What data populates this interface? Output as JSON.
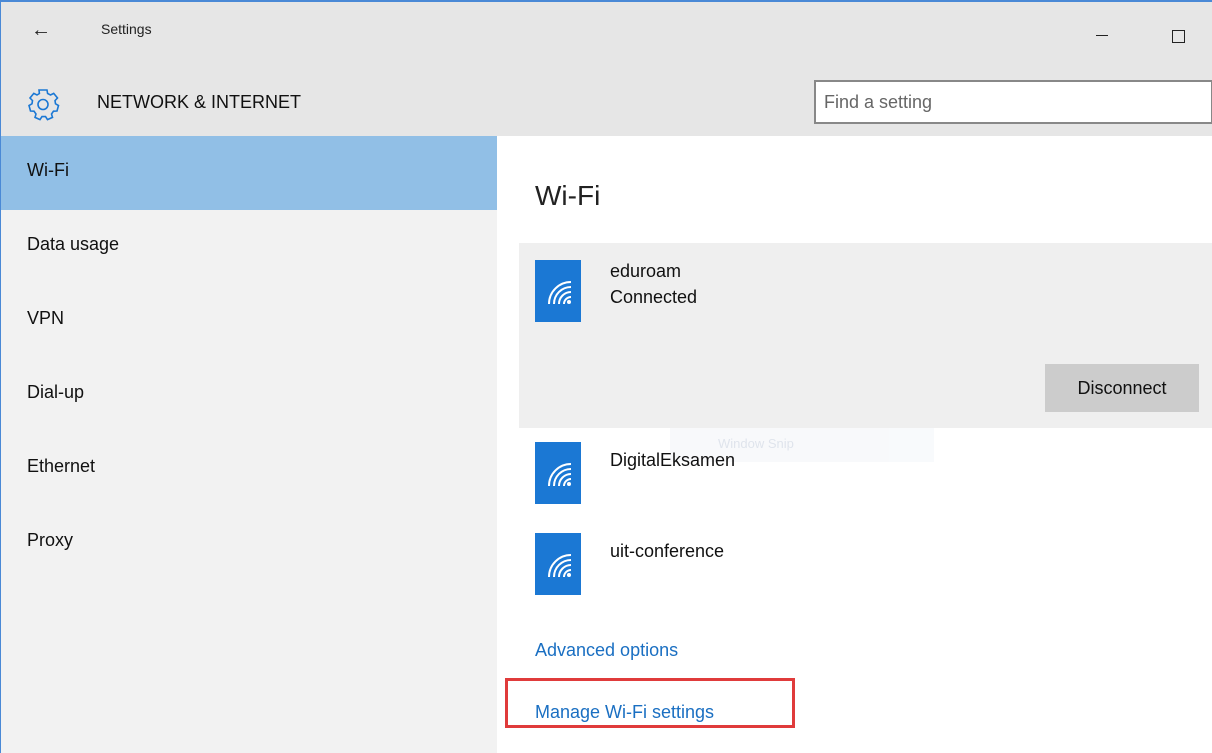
{
  "titlebar": {
    "back_icon": "back-arrow-icon",
    "title": "Settings",
    "minimize_icon": "minimize-icon",
    "maximize_icon": "maximize-icon"
  },
  "header": {
    "icon": "gear-icon",
    "section_title": "NETWORK & INTERNET",
    "search_placeholder": "Find a setting"
  },
  "sidebar": {
    "items": [
      {
        "label": "Wi-Fi",
        "active": true
      },
      {
        "label": "Data usage",
        "active": false
      },
      {
        "label": "VPN",
        "active": false
      },
      {
        "label": "Dial-up",
        "active": false
      },
      {
        "label": "Ethernet",
        "active": false
      },
      {
        "label": "Proxy",
        "active": false
      }
    ]
  },
  "main": {
    "title": "Wi-Fi",
    "networks": [
      {
        "name": "eduroam",
        "status": "Connected",
        "icon": "wifi-signal-icon"
      },
      {
        "name": "DigitalEksamen",
        "icon": "wifi-signal-icon"
      },
      {
        "name": "uit-conference",
        "icon": "wifi-signal-icon"
      }
    ],
    "disconnect_label": "Disconnect",
    "ghost_text": "Window Snip",
    "advanced_options": "Advanced options",
    "manage_wifi": "Manage Wi-Fi settings"
  },
  "colors": {
    "accent": "#1b78d4",
    "link": "#1a6fc2",
    "sidebar_active": "#91bfe6",
    "highlight": "#e03b3b"
  }
}
